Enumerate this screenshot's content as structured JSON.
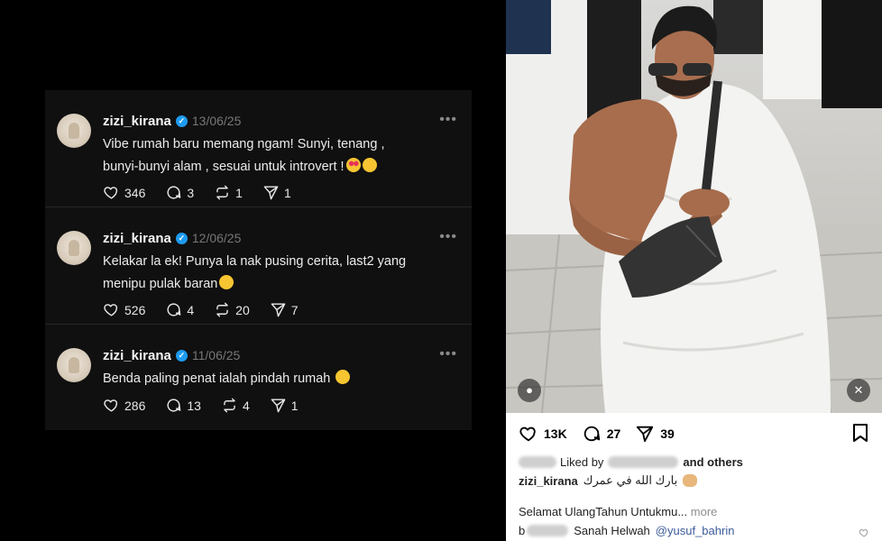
{
  "threads": {
    "posts": [
      {
        "username": "zizi_kirana",
        "date": "13/06/25",
        "text_line1": "Vibe rumah baru memang ngam! Sunyi, tenang ,",
        "text_line2": "bunyi-bunyi alam , sesuai untuk introvert !",
        "likes": "346",
        "replies": "3",
        "reposts": "1",
        "shares": "1"
      },
      {
        "username": "zizi_kirana",
        "date": "12/06/25",
        "text_line1": "Kelakar la ek! Punya la nak pusing cerita, last2 yang",
        "text_line2": "menipu pulak baran",
        "likes": "526",
        "replies": "4",
        "reposts": "20",
        "shares": "7"
      },
      {
        "username": "zizi_kirana",
        "date": "11/06/25",
        "text_line1": "Benda paling penat ialah pindah rumah",
        "text_line2": "",
        "likes": "286",
        "replies": "13",
        "reposts": "4",
        "shares": "1"
      }
    ]
  },
  "instagram": {
    "likes": "13K",
    "comments": "27",
    "shares": "39",
    "liked_by_prefix": "Liked by",
    "liked_by_suffix": "and others",
    "caption_user": "zizi_kirana",
    "caption_text": "بارك الله في عمرك",
    "caption_line2": "Selamat UlangTahun Untukmu...",
    "more_label": "more",
    "comment_initial": "b",
    "comment_text": "Sanah Helwah",
    "comment_mention": "@yusuf_bahrin"
  },
  "icons": {
    "like": "heart-icon",
    "reply": "comment-icon",
    "repost": "repost-icon",
    "share": "send-icon",
    "save": "bookmark-icon",
    "tag": "user-tag-icon",
    "mute": "mute-icon"
  }
}
